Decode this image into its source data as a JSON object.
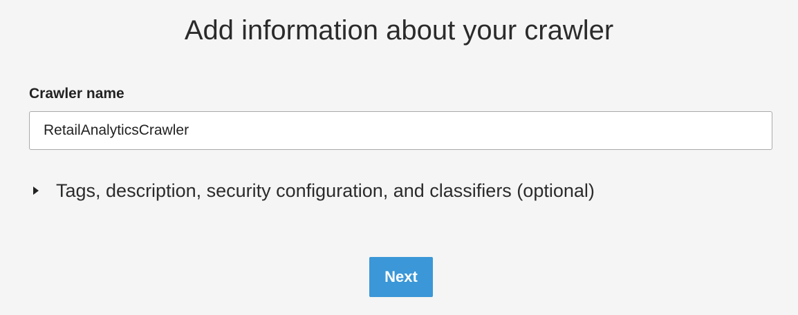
{
  "page": {
    "title": "Add information about your crawler"
  },
  "crawler_name": {
    "label": "Crawler name",
    "value": "RetailAnalyticsCrawler",
    "placeholder": ""
  },
  "optional_section": {
    "label": "Tags, description, security configuration, and classifiers (optional)",
    "icon": "caret-right-icon",
    "expanded": false
  },
  "actions": {
    "next_label": "Next"
  },
  "colors": {
    "background": "#f4f5f4",
    "primary_button": "#3b97d7",
    "input_border": "#a9a9a9"
  }
}
